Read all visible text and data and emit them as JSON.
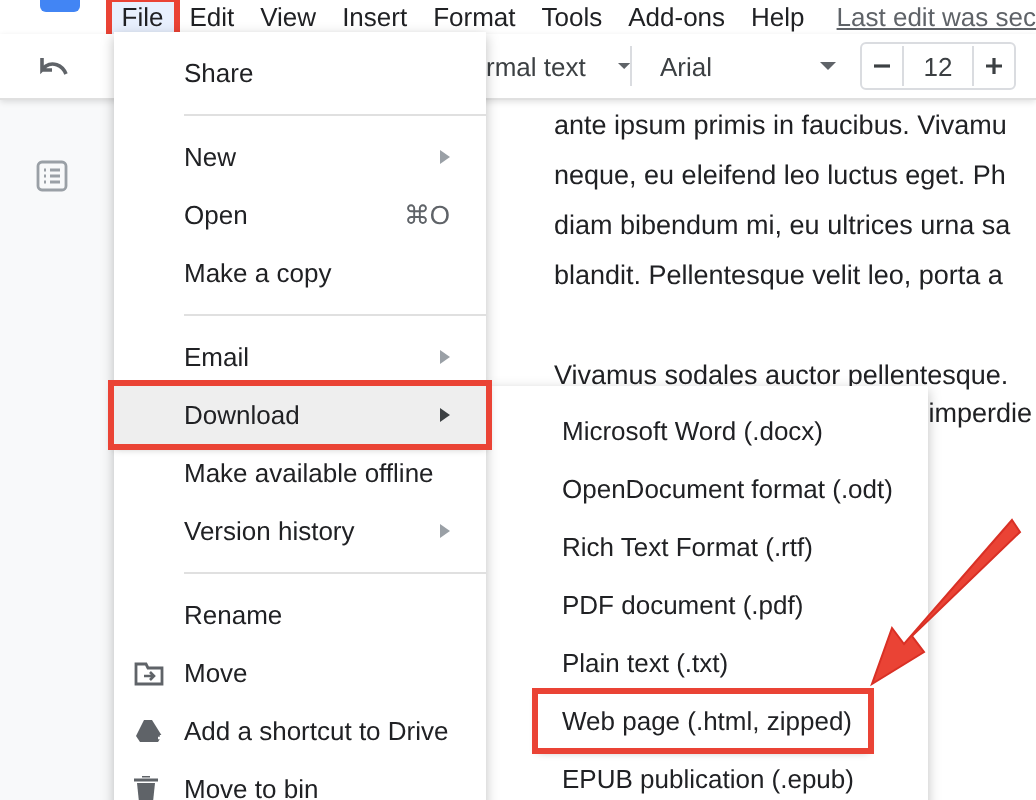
{
  "menu_bar": {
    "items": [
      {
        "label": "File",
        "selected": true,
        "highlighted": true
      },
      {
        "label": "Edit",
        "selected": false,
        "highlighted": false
      },
      {
        "label": "View",
        "selected": false,
        "highlighted": false
      },
      {
        "label": "Insert",
        "selected": false,
        "highlighted": false
      },
      {
        "label": "Format",
        "selected": false,
        "highlighted": false
      },
      {
        "label": "Tools",
        "selected": false,
        "highlighted": false
      },
      {
        "label": "Add-ons",
        "selected": false,
        "highlighted": false
      },
      {
        "label": "Help",
        "selected": false,
        "highlighted": false
      }
    ],
    "last_edit": "Last edit was sec"
  },
  "toolbar": {
    "style": "rmal text",
    "font": "Arial",
    "font_size": "12"
  },
  "document": {
    "paragraphs": [
      [
        "ante ipsum primis in faucibus. Vivamu",
        "neque, eu eleifend leo luctus eget. Ph",
        "diam bibendum mi, eu ultrices urna sa",
        "blandit. Pellentesque velit leo, porta a"
      ],
      [
        "Vivamus sodales auctor pellentesque."
      ]
    ],
    "covered_line": "imperdie"
  },
  "file_menu": {
    "items": [
      {
        "kind": "item",
        "label": "Share",
        "selected": false,
        "highlighted": false
      },
      {
        "kind": "divider"
      },
      {
        "kind": "item",
        "label": "New",
        "submenu": true,
        "selected": false,
        "highlighted": false
      },
      {
        "kind": "item",
        "label": "Open",
        "shortcut": "⌘O",
        "selected": false,
        "highlighted": false
      },
      {
        "kind": "item",
        "label": "Make a copy",
        "selected": false,
        "highlighted": false
      },
      {
        "kind": "divider"
      },
      {
        "kind": "item",
        "label": "Email",
        "submenu": true,
        "selected": false,
        "highlighted": false
      },
      {
        "kind": "item",
        "label": "Download",
        "submenu": true,
        "selected": true,
        "highlighted": true
      },
      {
        "kind": "item",
        "label": "Make available offline",
        "selected": false,
        "highlighted": false
      },
      {
        "kind": "item",
        "label": "Version history",
        "submenu": true,
        "selected": false,
        "highlighted": false
      },
      {
        "kind": "divider"
      },
      {
        "kind": "item",
        "label": "Rename",
        "selected": false,
        "highlighted": false
      },
      {
        "kind": "move",
        "label": "Move",
        "selected": false,
        "highlighted": false
      },
      {
        "kind": "shortcut",
        "label": "Add a shortcut to Drive",
        "selected": false,
        "highlighted": false
      },
      {
        "kind": "trash",
        "label": "Move to bin",
        "selected": false,
        "highlighted": false
      }
    ]
  },
  "download_menu": {
    "items": [
      {
        "label": "Microsoft Word (.docx)",
        "highlighted": false
      },
      {
        "label": "OpenDocument format (.odt)",
        "highlighted": false
      },
      {
        "label": "Rich Text Format (.rtf)",
        "highlighted": false
      },
      {
        "label": "PDF document (.pdf)",
        "highlighted": false
      },
      {
        "label": "Plain text (.txt)",
        "highlighted": false
      },
      {
        "label": "Web page (.html, zipped)",
        "highlighted": true
      },
      {
        "label": "EPUB publication (.epub)",
        "highlighted": false
      }
    ]
  }
}
